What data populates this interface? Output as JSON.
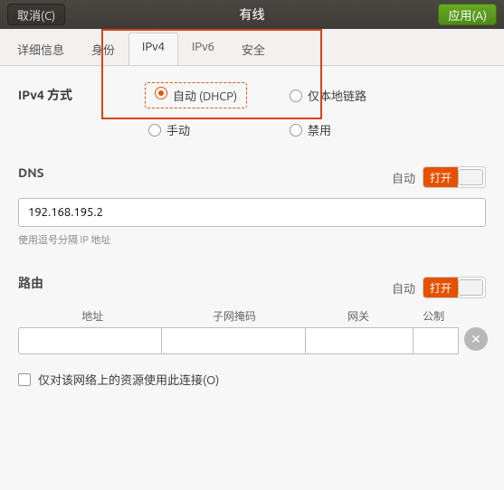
{
  "titlebar": {
    "cancel": "取消(C)",
    "title": "有线",
    "apply": "应用(A)"
  },
  "tabs": {
    "details": "详细信息",
    "identity": "身份",
    "ipv4": "IPv4",
    "ipv6": "IPv6",
    "security": "安全"
  },
  "ipv4": {
    "method_label": "IPv4 方式",
    "options": {
      "auto": "自动 (DHCP)",
      "link_local": "仅本地链路",
      "manual": "手动",
      "disabled": "禁用"
    }
  },
  "dns": {
    "label": "DNS",
    "auto_label": "自动",
    "toggle_on": "打开",
    "value": "192.168.195.2",
    "hint": "使用逗号分隔 IP 地址"
  },
  "routes": {
    "label": "路由",
    "auto_label": "自动",
    "toggle_on": "打开",
    "cols": {
      "addr": "地址",
      "mask": "子网掩码",
      "gw": "网关",
      "metric": "公制"
    },
    "only_this": "仅对该网络上的资源使用此连接(O)"
  }
}
